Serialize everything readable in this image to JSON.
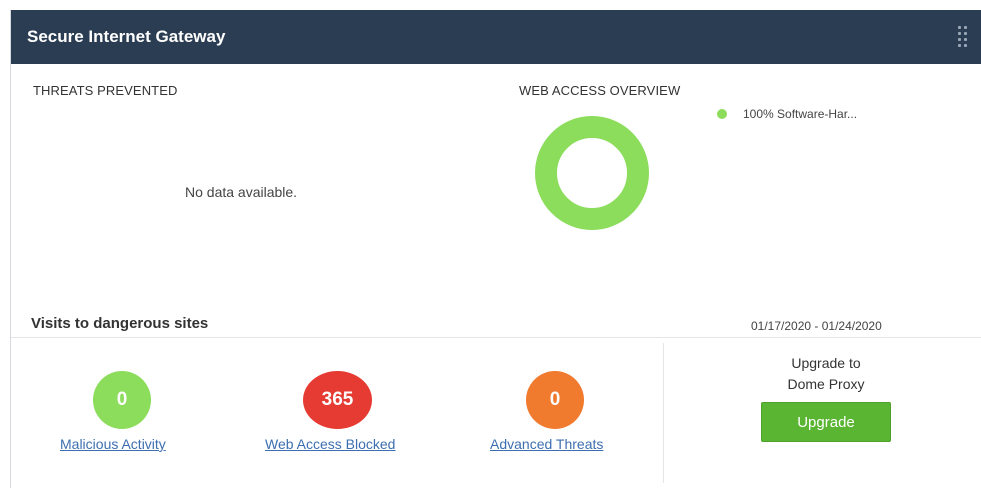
{
  "widget": {
    "title": "Secure Internet Gateway",
    "drag_icon": "drag-handle-icon"
  },
  "threats_prevented": {
    "label": "THREATS PREVENTED",
    "empty_text": "No data available."
  },
  "web_access_overview": {
    "label": "WEB ACCESS OVERVIEW",
    "chart_data": {
      "type": "pie",
      "categories": [
        "Software-Har..."
      ],
      "values": [
        100
      ],
      "legend_labels": [
        "100% Software-Har..."
      ],
      "colors": [
        "#8bdd5b"
      ],
      "legend_position": "top-right"
    }
  },
  "visits": {
    "title": "Visits to dangerous sites",
    "date_range": "01/17/2020 - 01/24/2020",
    "stats": [
      {
        "value": "0",
        "label": "Malicious Activity",
        "color": "#8bdd5b"
      },
      {
        "value": "365",
        "label": "Web Access Blocked",
        "color": "#e63b32"
      },
      {
        "value": "0",
        "label": "Advanced Threats",
        "color": "#f07a2e"
      }
    ]
  },
  "upgrade": {
    "line1": "Upgrade to",
    "line2": "Dome Proxy",
    "button_label": "Upgrade",
    "button_color": "#5ab532"
  }
}
